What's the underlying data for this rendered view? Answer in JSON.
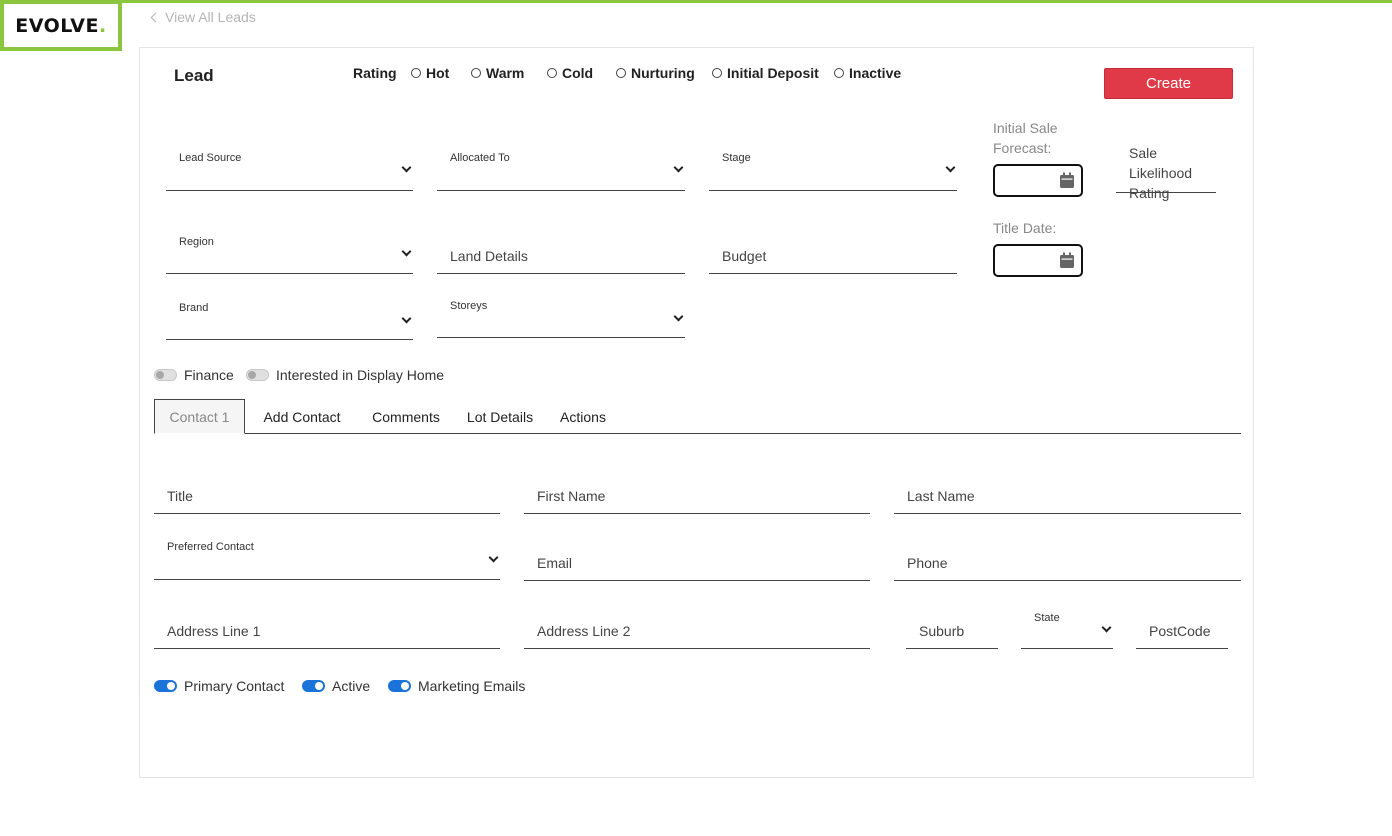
{
  "brand": {
    "logo_text": "EVOLVE",
    "logo_dot": ".",
    "accent": "#8cc63f"
  },
  "nav": {
    "back_label": "View All Leads"
  },
  "lead": {
    "title": "Lead",
    "rating_label": "Rating",
    "rating_options": [
      "Hot",
      "Warm",
      "Cold",
      "Nurturing",
      "Initial Deposit",
      "Inactive"
    ],
    "create_label": "Create",
    "create_color": "#e03a48"
  },
  "fields": {
    "lead_source": "Lead Source",
    "allocated_to": "Allocated To",
    "stage": "Stage",
    "initial_sale_forecast": "Initial Sale Forecast:",
    "sale_likelihood": "Sale Likelihood Rating",
    "region": "Region",
    "land_details": "Land Details",
    "budget": "Budget",
    "title_date": "Title Date:",
    "brand": "Brand",
    "storeys": "Storeys"
  },
  "toggles": {
    "finance": "Finance",
    "display_home": "Interested in Display Home"
  },
  "tabs": [
    "Contact 1",
    "Add Contact",
    "Comments",
    "Lot Details",
    "Actions"
  ],
  "contact": {
    "title": "Title",
    "first_name": "First Name",
    "last_name": "Last Name",
    "preferred_contact": "Preferred Contact",
    "email": "Email",
    "phone": "Phone",
    "address1": "Address Line 1",
    "address2": "Address Line 2",
    "suburb": "Suburb",
    "state": "State",
    "postcode": "PostCode",
    "primary_contact": "Primary Contact",
    "active": "Active",
    "marketing_emails": "Marketing Emails",
    "toggle_color": "#1a73d9"
  }
}
